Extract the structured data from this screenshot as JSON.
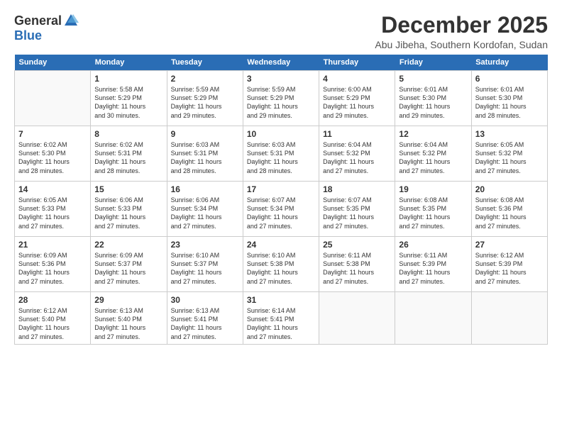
{
  "logo": {
    "general": "General",
    "blue": "Blue"
  },
  "title": "December 2025",
  "location": "Abu Jibeha, Southern Kordofan, Sudan",
  "days_header": [
    "Sunday",
    "Monday",
    "Tuesday",
    "Wednesday",
    "Thursday",
    "Friday",
    "Saturday"
  ],
  "weeks": [
    [
      {
        "day": "",
        "info": ""
      },
      {
        "day": "1",
        "info": "Sunrise: 5:58 AM\nSunset: 5:29 PM\nDaylight: 11 hours\nand 30 minutes."
      },
      {
        "day": "2",
        "info": "Sunrise: 5:59 AM\nSunset: 5:29 PM\nDaylight: 11 hours\nand 29 minutes."
      },
      {
        "day": "3",
        "info": "Sunrise: 5:59 AM\nSunset: 5:29 PM\nDaylight: 11 hours\nand 29 minutes."
      },
      {
        "day": "4",
        "info": "Sunrise: 6:00 AM\nSunset: 5:29 PM\nDaylight: 11 hours\nand 29 minutes."
      },
      {
        "day": "5",
        "info": "Sunrise: 6:01 AM\nSunset: 5:30 PM\nDaylight: 11 hours\nand 29 minutes."
      },
      {
        "day": "6",
        "info": "Sunrise: 6:01 AM\nSunset: 5:30 PM\nDaylight: 11 hours\nand 28 minutes."
      }
    ],
    [
      {
        "day": "7",
        "info": "Sunrise: 6:02 AM\nSunset: 5:30 PM\nDaylight: 11 hours\nand 28 minutes."
      },
      {
        "day": "8",
        "info": "Sunrise: 6:02 AM\nSunset: 5:31 PM\nDaylight: 11 hours\nand 28 minutes."
      },
      {
        "day": "9",
        "info": "Sunrise: 6:03 AM\nSunset: 5:31 PM\nDaylight: 11 hours\nand 28 minutes."
      },
      {
        "day": "10",
        "info": "Sunrise: 6:03 AM\nSunset: 5:31 PM\nDaylight: 11 hours\nand 28 minutes."
      },
      {
        "day": "11",
        "info": "Sunrise: 6:04 AM\nSunset: 5:32 PM\nDaylight: 11 hours\nand 27 minutes."
      },
      {
        "day": "12",
        "info": "Sunrise: 6:04 AM\nSunset: 5:32 PM\nDaylight: 11 hours\nand 27 minutes."
      },
      {
        "day": "13",
        "info": "Sunrise: 6:05 AM\nSunset: 5:32 PM\nDaylight: 11 hours\nand 27 minutes."
      }
    ],
    [
      {
        "day": "14",
        "info": "Sunrise: 6:05 AM\nSunset: 5:33 PM\nDaylight: 11 hours\nand 27 minutes."
      },
      {
        "day": "15",
        "info": "Sunrise: 6:06 AM\nSunset: 5:33 PM\nDaylight: 11 hours\nand 27 minutes."
      },
      {
        "day": "16",
        "info": "Sunrise: 6:06 AM\nSunset: 5:34 PM\nDaylight: 11 hours\nand 27 minutes."
      },
      {
        "day": "17",
        "info": "Sunrise: 6:07 AM\nSunset: 5:34 PM\nDaylight: 11 hours\nand 27 minutes."
      },
      {
        "day": "18",
        "info": "Sunrise: 6:07 AM\nSunset: 5:35 PM\nDaylight: 11 hours\nand 27 minutes."
      },
      {
        "day": "19",
        "info": "Sunrise: 6:08 AM\nSunset: 5:35 PM\nDaylight: 11 hours\nand 27 minutes."
      },
      {
        "day": "20",
        "info": "Sunrise: 6:08 AM\nSunset: 5:36 PM\nDaylight: 11 hours\nand 27 minutes."
      }
    ],
    [
      {
        "day": "21",
        "info": "Sunrise: 6:09 AM\nSunset: 5:36 PM\nDaylight: 11 hours\nand 27 minutes."
      },
      {
        "day": "22",
        "info": "Sunrise: 6:09 AM\nSunset: 5:37 PM\nDaylight: 11 hours\nand 27 minutes."
      },
      {
        "day": "23",
        "info": "Sunrise: 6:10 AM\nSunset: 5:37 PM\nDaylight: 11 hours\nand 27 minutes."
      },
      {
        "day": "24",
        "info": "Sunrise: 6:10 AM\nSunset: 5:38 PM\nDaylight: 11 hours\nand 27 minutes."
      },
      {
        "day": "25",
        "info": "Sunrise: 6:11 AM\nSunset: 5:38 PM\nDaylight: 11 hours\nand 27 minutes."
      },
      {
        "day": "26",
        "info": "Sunrise: 6:11 AM\nSunset: 5:39 PM\nDaylight: 11 hours\nand 27 minutes."
      },
      {
        "day": "27",
        "info": "Sunrise: 6:12 AM\nSunset: 5:39 PM\nDaylight: 11 hours\nand 27 minutes."
      }
    ],
    [
      {
        "day": "28",
        "info": "Sunrise: 6:12 AM\nSunset: 5:40 PM\nDaylight: 11 hours\nand 27 minutes."
      },
      {
        "day": "29",
        "info": "Sunrise: 6:13 AM\nSunset: 5:40 PM\nDaylight: 11 hours\nand 27 minutes."
      },
      {
        "day": "30",
        "info": "Sunrise: 6:13 AM\nSunset: 5:41 PM\nDaylight: 11 hours\nand 27 minutes."
      },
      {
        "day": "31",
        "info": "Sunrise: 6:14 AM\nSunset: 5:41 PM\nDaylight: 11 hours\nand 27 minutes."
      },
      {
        "day": "",
        "info": ""
      },
      {
        "day": "",
        "info": ""
      },
      {
        "day": "",
        "info": ""
      }
    ]
  ]
}
